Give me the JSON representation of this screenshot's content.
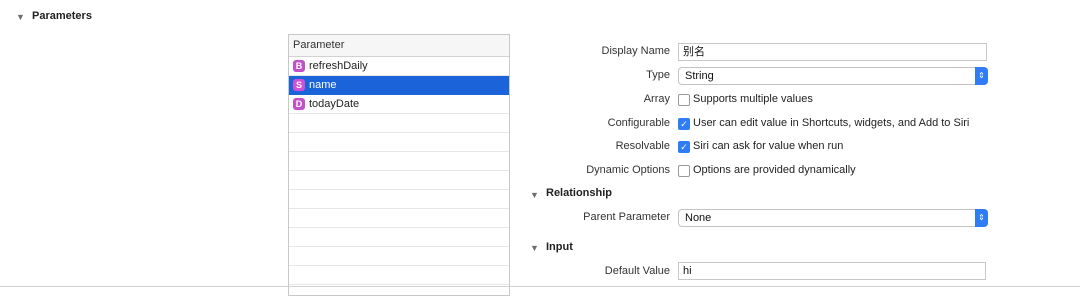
{
  "section": {
    "title": "Parameters"
  },
  "param_list": {
    "header": "Parameter",
    "items": [
      {
        "badge": "B",
        "label": "refreshDaily",
        "selected": false
      },
      {
        "badge": "S",
        "label": "name",
        "selected": true
      },
      {
        "badge": "D",
        "label": "todayDate",
        "selected": false
      }
    ]
  },
  "form": {
    "display_name": {
      "label": "Display Name",
      "value": "别名"
    },
    "type": {
      "label": "Type",
      "value": "String"
    },
    "array": {
      "label": "Array",
      "checkbox_label": "Supports multiple values",
      "checked": false
    },
    "configurable": {
      "label": "Configurable",
      "checkbox_label": "User can edit value in Shortcuts, widgets, and Add to Siri",
      "checked": true
    },
    "resolvable": {
      "label": "Resolvable",
      "checkbox_label": "Siri can ask for value when run",
      "checked": true
    },
    "dynamic_options": {
      "label": "Dynamic Options",
      "checkbox_label": "Options are provided dynamically",
      "checked": false
    },
    "relationship": {
      "title": "Relationship",
      "parent_parameter": {
        "label": "Parent Parameter",
        "value": "None"
      }
    },
    "input": {
      "title": "Input",
      "default_value": {
        "label": "Default Value",
        "value": "hi"
      }
    }
  },
  "colors": {
    "selection": "#1b63d8",
    "badge": "#c150c9",
    "accent": "#2f7cf6"
  }
}
